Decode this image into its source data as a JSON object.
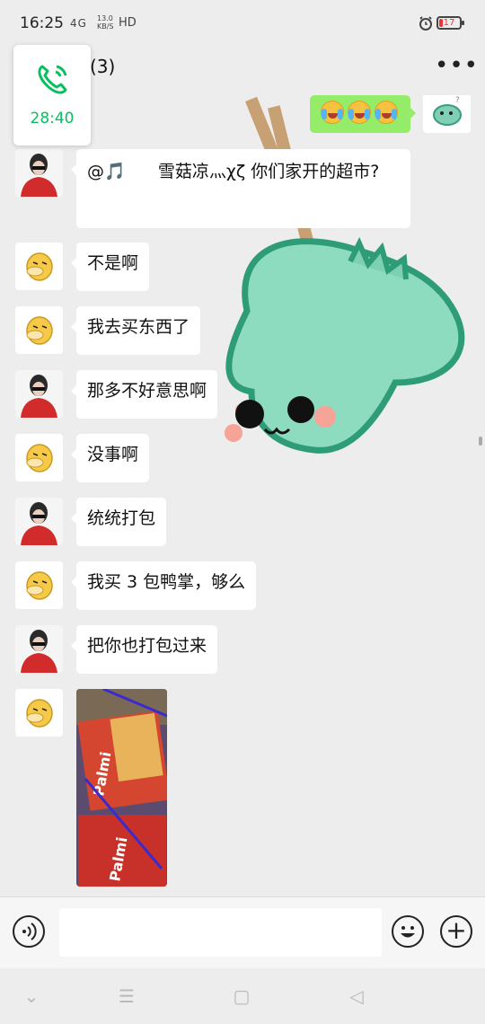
{
  "status": {
    "time": "16:25",
    "network": "4G",
    "speed_value": "13.0",
    "speed_unit": "KB/S",
    "hd": "HD",
    "battery": "17",
    "battery_level": 0.17
  },
  "header": {
    "title": "(3)",
    "more_label": "•••"
  },
  "call": {
    "timer": "28:40"
  },
  "messages": {
    "m1": "@🎵      雪菇凉灬χζ 你们家开的超市?",
    "m2": "不是啊",
    "m3": "我去买东西了",
    "m4": "那多不好意思啊",
    "m5": "没事啊",
    "m6": "统统打包",
    "m7": "我买 3 包鸭掌，够么",
    "m8": "把你也打包过来"
  },
  "image_msg": {
    "brand": "Palmi"
  },
  "input": {
    "placeholder": ""
  },
  "nav": {
    "down": "⌄",
    "menu": "☰",
    "home": "▢",
    "back": "◁"
  },
  "colors": {
    "accent": "#07c160",
    "out_bubble": "#95ec69",
    "background": "#ededed"
  }
}
